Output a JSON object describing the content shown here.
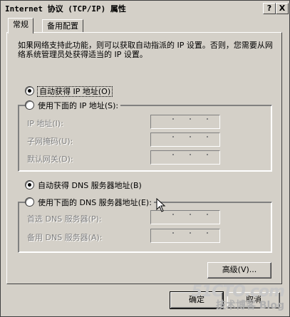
{
  "window": {
    "title": "Internet 协议 (TCP/IP) 属性",
    "help_label": "?",
    "close_label": "X"
  },
  "tabs": [
    {
      "label": "常规",
      "active": true
    },
    {
      "label": "备用配置",
      "active": false
    }
  ],
  "description": "如果网络支持此功能，则可以获取自动指派的 IP 设置。否则，您需要从网络系统管理员处获得适当的 IP 设置。",
  "ip_section": {
    "auto_label": "自动获得 IP 地址(O)",
    "manual_label": "使用下面的 IP 地址(S):",
    "selected": "auto",
    "fields": [
      {
        "label": "IP 地址(I):",
        "value": "",
        "enabled": false
      },
      {
        "label": "子网掩码(U):",
        "value": "",
        "enabled": false
      },
      {
        "label": "默认网关(D):",
        "value": "",
        "enabled": false
      }
    ]
  },
  "dns_section": {
    "auto_label": "自动获得 DNS 服务器地址(B)",
    "manual_label": "使用下面的 DNS 服务器地址(E):",
    "selected": "auto",
    "fields": [
      {
        "label": "首选 DNS 服务器(P):",
        "value": "",
        "enabled": false
      },
      {
        "label": "备用 DNS 服务器(A):",
        "value": "",
        "enabled": false
      }
    ]
  },
  "buttons": {
    "advanced": "高级(V)...",
    "ok": "确定",
    "cancel": "取消"
  },
  "watermark": {
    "site": "51CTO.com",
    "blog": "技术博客 Blog"
  }
}
